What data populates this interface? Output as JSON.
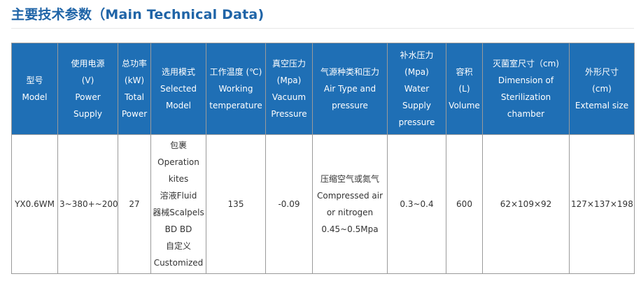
{
  "page": {
    "title": "主要技术参数（Main Technical Data)"
  },
  "table": {
    "headers": [
      {
        "id": "model",
        "lines": [
          "型号",
          "Model"
        ]
      },
      {
        "id": "power-supply",
        "lines": [
          "使用电源",
          "(V)",
          "Power",
          "Supply"
        ]
      },
      {
        "id": "total-power",
        "lines": [
          "总功率",
          "(kW)",
          "Total",
          "Power"
        ]
      },
      {
        "id": "selected-model",
        "lines": [
          "选用模式",
          "Selected",
          "Model"
        ]
      },
      {
        "id": "working-temperature",
        "lines": [
          "工作温度 (℃)",
          "Working",
          "temperature"
        ]
      },
      {
        "id": "vacuum-pressure",
        "lines": [
          "真空压力",
          "(Mpa)",
          "Vacuum",
          "Pressure"
        ]
      },
      {
        "id": "air-type-pressure",
        "lines": [
          "气源种类和压力",
          "Air Type and",
          "pressure"
        ]
      },
      {
        "id": "water-supply-pressure",
        "lines": [
          "补水压力",
          "(Mpa)",
          "Water",
          "Supply",
          "pressure"
        ]
      },
      {
        "id": "volume",
        "lines": [
          "容积",
          "(L)",
          "Volume"
        ]
      },
      {
        "id": "sterilization-chamber",
        "lines": [
          "灭菌室尺寸（cm)",
          "Dimension of",
          "Sterilization",
          "chamber"
        ]
      },
      {
        "id": "external-size",
        "lines": [
          "外形尺寸",
          "(cm)",
          "Extemal size"
        ]
      }
    ],
    "rows": [
      {
        "cells": [
          [
            "YX0.6WM"
          ],
          [
            "3~380+~200"
          ],
          [
            "27"
          ],
          [
            "包裹",
            "Operation",
            "kites",
            "溶液Fluid",
            "器械Scalpels",
            "BD BD",
            "自定义",
            "Customized"
          ],
          [
            "135"
          ],
          [
            "-0.09"
          ],
          [
            "压缩空气或氮气",
            "Compressed air",
            "or nitrogen",
            "0.45~0.5Mpa"
          ],
          [
            "0.3~0.4"
          ],
          [
            "600"
          ],
          [
            "62×109×92"
          ],
          [
            "127×137×198"
          ]
        ]
      }
    ]
  }
}
